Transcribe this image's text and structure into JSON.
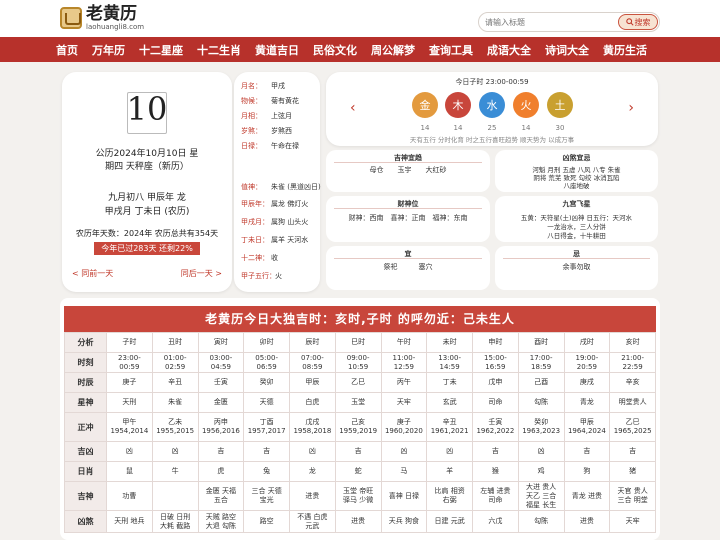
{
  "site": {
    "name": "老黄历",
    "url": "laohuangli8.com"
  },
  "search": {
    "placeholder": "请输入标题",
    "button": "搜索"
  },
  "nav": [
    "首页",
    "万年历",
    "十二星座",
    "十二生肖",
    "黄道吉日",
    "民俗文化",
    "周公解梦",
    "查询工具",
    "成语大全",
    "诗词大全",
    "黄历生活"
  ],
  "date": {
    "day": "10",
    "line1": "公历2024年10月10日 星",
    "line2": "期四 天秤座（新历）",
    "lunar1": "九月初八 甲辰年 龙",
    "lunar2": "甲戌月 丁未日 (农历)",
    "yearinfo": "农历年天数：2024年 农历总共有354天",
    "progress": "今年已过283天 还剩22%",
    "prev": "< 同前一天",
    "next": "同后一天 >"
  },
  "info": {
    "rows1": [
      {
        "k": "月名：",
        "v": "甲戌"
      },
      {
        "k": "物候：",
        "v": "菊有黄花"
      },
      {
        "k": "月相：",
        "v": "上弦月"
      },
      {
        "k": "岁煞：",
        "v": "岁煞西"
      },
      {
        "k": "日禄：",
        "v": "午命在禄"
      }
    ],
    "rows2": [
      {
        "k": "值神：",
        "v": "朱雀 (黑道凶日)"
      },
      {
        "k": "甲辰年：",
        "v": "属龙 佛灯火"
      },
      {
        "k": "甲戌月：",
        "v": "属狗 山头火"
      },
      {
        "k": "丁未日：",
        "v": "属羊 天河水"
      },
      {
        "k": "十二神：",
        "v": "收"
      },
      {
        "k": "甲子五行：",
        "v": "火"
      }
    ]
  },
  "wuxing": {
    "title": "今日子时 23:00-00:59",
    "elements": [
      {
        "glyph": "金",
        "num": "14",
        "color": "#e39a3e"
      },
      {
        "glyph": "木",
        "num": "14",
        "color": "#c8463b"
      },
      {
        "glyph": "水",
        "num": "25",
        "color": "#3a8dd6"
      },
      {
        "glyph": "火",
        "num": "14",
        "color": "#f07f2d"
      },
      {
        "glyph": "土",
        "num": "30",
        "color": "#c9a030"
      }
    ],
    "note": "天有五行 分时化育 时之五行喜旺趋势 顺天势为 以成万事",
    "prev_icon": "chevron-left-icon",
    "next_icon": "chevron-right-icon"
  },
  "boxes": {
    "jishen": {
      "title": "吉神宜趋",
      "text": "母仓　　玉宇　　大红砂"
    },
    "xiongsha": {
      "title": "凶煞宜忌",
      "lines": [
        "河魁 月刑 五虚 八风 八专 朱雀",
        "阴将 荒芜 致死 勾绞 冰消瓦陷",
        "八座地破"
      ]
    },
    "caishen": {
      "title": "财神位",
      "text": "财神：西南　喜神：正南　福神：东南"
    },
    "jiugong": {
      "title": "九宫飞星",
      "lines": [
        "五黄：天符星(土)凶神 日五行：天河水",
        "一龙治水，三人分饼",
        "八日得金，十牛耕田"
      ]
    },
    "yi": {
      "title": "宜",
      "text": "祭祀　　　塞穴"
    },
    "ji": {
      "title": "忌",
      "text": "余事勿取"
    }
  },
  "table": {
    "title": "老黄历今日大独吉时：亥时,子时 的呼勿近：己未生人",
    "rows": [
      {
        "h": "分析",
        "cls": "h1",
        "cells": [
          "子时",
          "丑时",
          "寅时",
          "卯时",
          "辰时",
          "巳时",
          "午时",
          "未时",
          "申时",
          "酉时",
          "戌时",
          "亥时"
        ]
      },
      {
        "h": "时刻",
        "cls": "h1",
        "cells": [
          "23:00-00:59",
          "01:00-02:59",
          "03:00-04:59",
          "05:00-06:59",
          "07:00-08:59",
          "09:00-10:59",
          "11:00-12:59",
          "13:00-14:59",
          "15:00-16:59",
          "17:00-18:59",
          "19:00-20:59",
          "21:00-22:59"
        ]
      },
      {
        "h": "时辰",
        "cls": "h1",
        "cells": [
          "庚子",
          "辛丑",
          "壬寅",
          "癸卯",
          "甲辰",
          "乙巳",
          "丙午",
          "丁未",
          "戊申",
          "己酉",
          "庚戌",
          "辛亥"
        ]
      },
      {
        "h": "星神",
        "cls": "h1",
        "cells": [
          "天刑",
          "朱雀",
          "金匮",
          "天德",
          "白虎",
          "玉堂",
          "天牢",
          "玄武",
          "司命",
          "勾陈",
          "青龙",
          "明堂贵人"
        ]
      },
      {
        "h": "正冲",
        "cls": "h2",
        "cells": [
          "甲午\n1954,2014",
          "乙未\n1955,2015",
          "丙申\n1956,2016",
          "丁酉\n1957,2017",
          "戊戌\n1958,2018",
          "己亥\n1959,2019",
          "庚子\n1960,2020",
          "辛丑\n1961,2021",
          "壬寅\n1962,2022",
          "癸卯\n1963,2023",
          "甲辰\n1964,2024",
          "乙巳\n1965,2025"
        ]
      },
      {
        "h": "吉凶",
        "cls": "h1",
        "cells": [
          "凶",
          "凶",
          "吉",
          "吉",
          "凶",
          "吉",
          "凶",
          "凶",
          "吉",
          "凶",
          "吉",
          "吉"
        ]
      },
      {
        "h": "日肖",
        "cls": "h1",
        "cells": [
          "鼠",
          "牛",
          "虎",
          "兔",
          "龙",
          "蛇",
          "马",
          "羊",
          "猴",
          "鸡",
          "狗",
          "猪"
        ]
      },
      {
        "h": "吉神",
        "cls": "h2",
        "cells": [
          "功曹",
          "",
          "金匮 天福\n五合",
          "三合 天德\n宝光",
          "进贵",
          "玉堂 帝旺\n驿马 少微",
          "喜神 日禄",
          "比肩 相资\n右弼",
          "左辅 进贵\n司命",
          "大进 贵人\n天乙 三合\n福星 长生",
          "青龙 进贵",
          "天官 贵人\n三合 明堂"
        ]
      },
      {
        "h": "凶煞",
        "cls": "h3",
        "cells": [
          "天刑 地兵",
          "日破 日刑\n大耗 截路",
          "天贼 路空\n大退 勾陈",
          "路空",
          "不遇 白虎\n元武",
          "进贵",
          "天兵 狗食",
          "日建 元武",
          "六戊",
          "勾陈",
          "进贵",
          "天牢"
        ]
      }
    ]
  }
}
